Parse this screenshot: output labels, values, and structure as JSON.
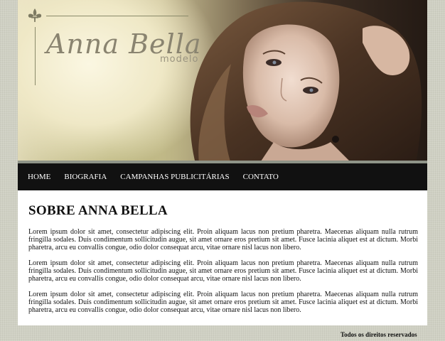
{
  "brand": {
    "name": "Anna Bella",
    "tagline": "modelo",
    "emblem_icon": "fleur-de-lis-icon"
  },
  "hero": {
    "image": "model-portrait"
  },
  "nav": {
    "items": [
      {
        "label": "HOME"
      },
      {
        "label": "BIOGRAFIA"
      },
      {
        "label": "CAMPANHAS PUBLICITÁRIAS"
      },
      {
        "label": "CONTATO"
      }
    ]
  },
  "content": {
    "title": "SOBRE ANNA BELLA",
    "paragraphs": [
      "Lorem ipsum dolor sit amet, consectetur adipiscing elit. Proin aliquam lacus non pretium pharetra. Maecenas aliquam nulla rutrum fringilla sodales. Duis condimentum sollicitudin augue, sit amet ornare eros pretium sit amet. Fusce lacinia aliquet est at dictum. Morbi pharetra, arcu eu convallis congue, odio dolor consequat arcu, vitae ornare nisl lacus non libero.",
      "Lorem ipsum dolor sit amet, consectetur adipiscing elit. Proin aliquam lacus non pretium pharetra. Maecenas aliquam nulla rutrum fringilla sodales. Duis condimentum sollicitudin augue, sit amet ornare eros pretium sit amet. Fusce lacinia aliquet est at dictum. Morbi pharetra, arcu eu convallis congue, odio dolor consequat arcu, vitae ornare nisl lacus non libero.",
      "Lorem ipsum dolor sit amet, consectetur adipiscing elit. Proin aliquam lacus non pretium pharetra. Maecenas aliquam nulla rutrum fringilla sodales. Duis condimentum sollicitudin augue, sit amet ornare eros pretium sit amet. Fusce lacinia aliquet est at dictum. Morbi pharetra, arcu eu convallis congue, odio dolor consequat arcu, vitae ornare nisl lacus non libero."
    ]
  },
  "footer": {
    "text": "Todos os direitos reservados"
  },
  "colors": {
    "page_background": "#cfd0c3",
    "nav_background": "#111111",
    "nav_text": "#ffffff",
    "content_background": "#ffffff",
    "brand_text": "#8a8470"
  }
}
